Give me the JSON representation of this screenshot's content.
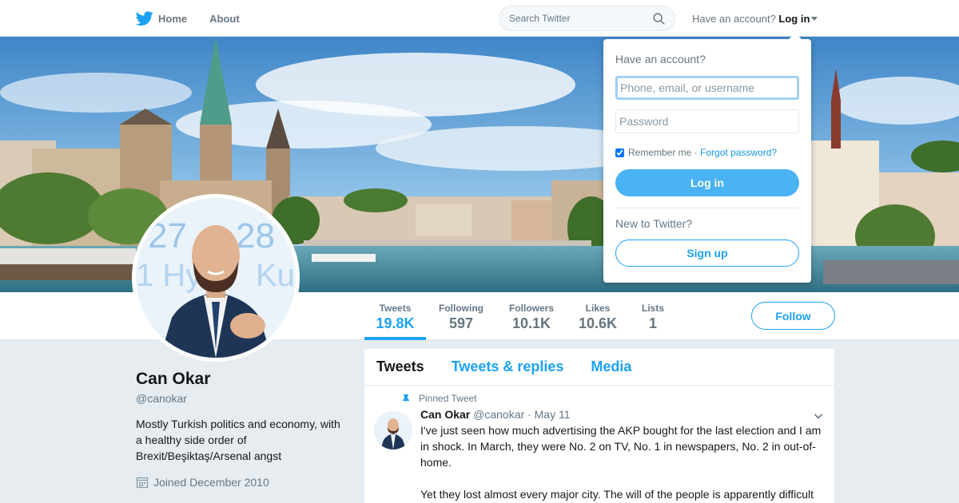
{
  "nav": {
    "home_label": "Home",
    "about_label": "About",
    "search_placeholder": "Search Twitter",
    "have_account": "Have an account?",
    "login_label": "Log in"
  },
  "profile": {
    "name": "Can Okar",
    "handle": "@canokar",
    "bio": "Mostly Turkish politics and economy, with a healthy side order of Brexit/Beşiktaş/Arsenal angst",
    "joined": "Joined December 2010",
    "follow_label": "Follow"
  },
  "stats": [
    {
      "label": "Tweets",
      "value": "19.8K"
    },
    {
      "label": "Following",
      "value": "597"
    },
    {
      "label": "Followers",
      "value": "10.1K"
    },
    {
      "label": "Likes",
      "value": "10.6K"
    },
    {
      "label": "Lists",
      "value": "1"
    }
  ],
  "timeline": {
    "tabs": [
      "Tweets",
      "Tweets & replies",
      "Media"
    ],
    "active_tab": "Tweets",
    "pinned_label": "Pinned Tweet",
    "tweet": {
      "author_name": "Can Okar",
      "author_handle": "@canokar",
      "date": "· May 11",
      "text_p1": "I've just seen how much advertising the AKP bought for the last election and I am in shock. In March, they were No. 2 on TV, No. 1 in newspapers, No. 2 in out-of-home.",
      "text_p2": "Yet they lost almost every major city. The will of the people is apparently difficult"
    }
  },
  "login_dropdown": {
    "title": "Have an account?",
    "username_placeholder": "Phone, email, or username",
    "password_placeholder": "Password",
    "remember_label": "Remember me",
    "separator": " · ",
    "forgot_label": "Forgot password?",
    "login_button": "Log in",
    "new_label": "New to Twitter?",
    "signup_button": "Sign up"
  },
  "avatar_backdrop_text": [
    "27",
    "28",
    "1 Hy",
    "Ku"
  ],
  "colors": {
    "accent": "#1da1f2",
    "login_button_bg": "#4ab3f4",
    "page_bg": "#e6ecf0"
  },
  "icons": [
    "twitter-bird-icon",
    "search-icon",
    "caret-down-icon",
    "calendar-icon",
    "pin-icon",
    "chevron-down-icon"
  ]
}
